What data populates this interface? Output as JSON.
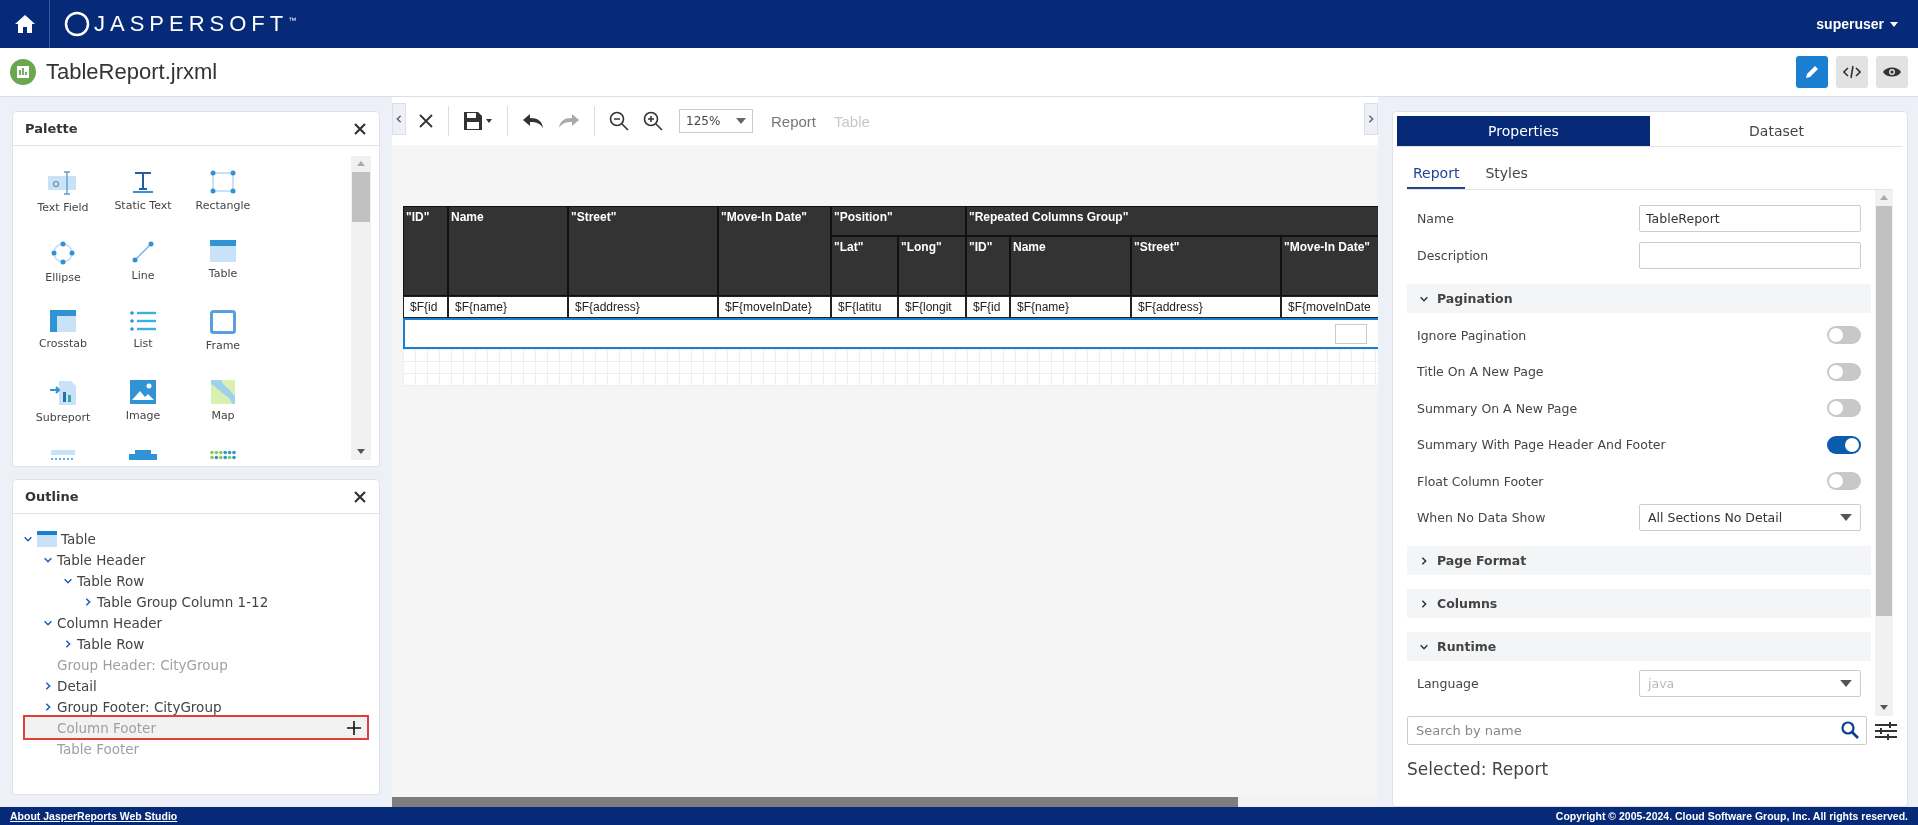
{
  "topbar": {
    "logo": "JASPERSOFT$^{™}$",
    "user": "superuser"
  },
  "titlebar": {
    "title": "TableReport.jrxml",
    "modes": [
      {
        "kind": "edit",
        "selected": true
      },
      {
        "kind": "code",
        "selected": false
      },
      {
        "kind": "preview",
        "selected": false
      }
    ]
  },
  "palette": {
    "title": "Palette",
    "items": [
      {
        "kind": "textfield",
        "label": "Text Field"
      },
      {
        "kind": "statictext",
        "label": "Static Text"
      },
      {
        "kind": "rectangle",
        "label": "Rectangle"
      },
      {
        "kind": "ellipse",
        "label": "Ellipse"
      },
      {
        "kind": "line",
        "label": "Line"
      },
      {
        "kind": "table",
        "label": "Table"
      },
      {
        "kind": "crosstab",
        "label": "Crosstab"
      },
      {
        "kind": "list",
        "label": "List"
      },
      {
        "kind": "frame",
        "label": "Frame"
      },
      {
        "kind": "subreport",
        "label": "Subreport"
      },
      {
        "kind": "image",
        "label": "Image"
      },
      {
        "kind": "map",
        "label": "Map"
      },
      {
        "kind": "break"
      },
      {
        "kind": "button"
      },
      {
        "kind": "dots"
      }
    ]
  },
  "outline": {
    "title": "Outline",
    "tree": [
      {
        "label": "Table",
        "icon": true,
        "expanded": true,
        "children": [
          {
            "label": "Table Header",
            "expanded": true,
            "children": [
              {
                "label": "Table Row",
                "expanded": true,
                "children": [
                  {
                    "label": "Table Group Column 1-12",
                    "expanded": false
                  }
                ]
              }
            ]
          },
          {
            "label": "Column Header",
            "expanded": true,
            "children": [
              {
                "label": "Table Row",
                "expanded": false
              }
            ]
          },
          {
            "label": "Group Header: CityGroup",
            "disabled": true
          },
          {
            "label": "Detail",
            "expanded": false
          },
          {
            "label": "Group Footer: CityGroup",
            "expanded": false
          },
          {
            "label": "Column Footer",
            "disabled": true,
            "highlighted": true
          },
          {
            "label": "Table Footer",
            "disabled": true
          }
        ]
      }
    ]
  },
  "toolbar": {
    "zoom": "125%",
    "breadcrumbs": [
      {
        "label": "Report",
        "disabled": false
      },
      {
        "label": "Table",
        "disabled": true
      }
    ],
    "redo_disabled": true
  },
  "table": {
    "header": [
      {
        "label": "\"ID\""
      },
      {
        "label": "Name"
      },
      {
        "label": "\"Street\""
      },
      {
        "label": "\"Move-In Date\""
      },
      {
        "label": "\"Position\"",
        "children": [
          "\"Lat\"",
          "\"Long\""
        ]
      },
      {
        "label": "\"Repeated Columns Group\"",
        "children": [
          "\"ID\"",
          "Name",
          "\"Street\"",
          "\"Move-In Date\""
        ]
      }
    ],
    "detail": [
      "$F{id",
      "$F{name}",
      "$F{address}",
      "$F{moveInDate}",
      "$F{latitu",
      "$F{longit",
      "$F{id",
      "$F{name}",
      "$F{address}",
      "$F{moveInDate"
    ]
  },
  "properties": {
    "tabs": [
      {
        "label": "Properties",
        "selected": true
      },
      {
        "label": "Dataset",
        "selected": false
      }
    ],
    "subtabs": [
      {
        "label": "Report",
        "selected": true
      },
      {
        "label": "Styles",
        "selected": false
      }
    ],
    "fields": [
      {
        "label": "Name",
        "value": "TableReport"
      },
      {
        "label": "Description"
      }
    ],
    "sections": [
      {
        "title": "Pagination",
        "expanded": true,
        "rows": [
          {
            "kind": "toggle",
            "label": "Ignore Pagination",
            "on": false
          },
          {
            "kind": "toggle",
            "label": "Title On A New Page",
            "on": false
          },
          {
            "kind": "toggle",
            "label": "Summary On A New Page",
            "on": false
          },
          {
            "kind": "toggle",
            "label": "Summary With Page Header And Footer",
            "on": true
          },
          {
            "kind": "toggle",
            "label": "Float Column Footer",
            "on": false
          },
          {
            "kind": "select",
            "label": "When No Data Show",
            "value": "All Sections No Detail",
            "disabled": false
          }
        ]
      },
      {
        "title": "Page Format",
        "expanded": false
      },
      {
        "title": "Columns",
        "expanded": false
      },
      {
        "title": "Runtime",
        "expanded": true,
        "rows": [
          {
            "kind": "select",
            "label": "Language",
            "value": "java",
            "disabled": true
          }
        ]
      }
    ],
    "search": {
      "placeholder": "Search by name"
    },
    "selected": "Selected: Report"
  },
  "footer": {
    "link": "About JasperReports Web Studio",
    "copyright": "Copyright © 2005-2024. Cloud Software Group, Inc. All rights reserved."
  }
}
